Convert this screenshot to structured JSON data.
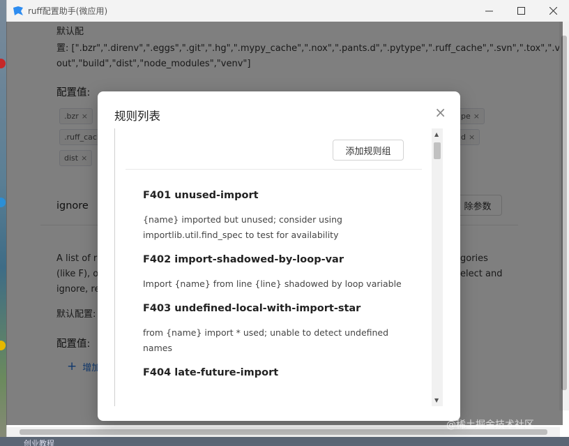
{
  "window": {
    "title": "ruff配置助手(微应用)",
    "minimize_icon": "minimize-icon",
    "maximize_icon": "maximize-icon",
    "close_icon": "close-icon"
  },
  "background": {
    "default_label": "默认配",
    "default_line1": "置: [\".bzr\",\".direnv\",\".eggs\",\".git\",\".hg\",\".mypy_cache\",\".nox\",\".pants.d\",\".pytype\",\".ruff_cache\",\".svn\",\".tox\",\".venv\",\"__py",
    "default_line2": "out\",\"build\",\"dist\",\"node_modules\",\"venv\"]",
    "config_value_label": "配置值:",
    "tags": [
      ".bzr",
      ".ruff_cach",
      "dist",
      "pe",
      "d"
    ],
    "tag_remove": "×",
    "section_name": "ignore",
    "delete_param": "除参数",
    "desc_line1": "A list of ru",
    "desc_line1_right": "gories",
    "desc_line2": "(like F), or",
    "desc_line2_right": "elect and",
    "desc_line3": "ignore, re",
    "default_label2": "默认配置:",
    "config_value_label2": "配置值:",
    "add_link": "增加",
    "add_icon": "+"
  },
  "dialog": {
    "title": "规则列表",
    "close": "×",
    "add_group_button": "添加规则组",
    "rules": [
      {
        "title": "F401 unused-import",
        "desc": "{name} imported but unused; consider using\nimportlib.util.find_spec to test for availability"
      },
      {
        "title": "F402 import-shadowed-by-loop-var",
        "desc": "Import {name} from line {line} shadowed by loop variable"
      },
      {
        "title": "F403 undefined-local-with-import-star",
        "desc": "from {name} import * used; unable to detect undefined\nnames"
      },
      {
        "title": "F404 late-future-import",
        "desc": ""
      }
    ],
    "scroll_up": "▲",
    "scroll_down": "▼"
  },
  "desktop": {
    "bottom_text": "创业教程"
  },
  "watermark": "@稀土掘金技术社区",
  "colors": {
    "accent": "#1e6fd9",
    "overlay": "rgba(0,0,0,0.5)"
  }
}
